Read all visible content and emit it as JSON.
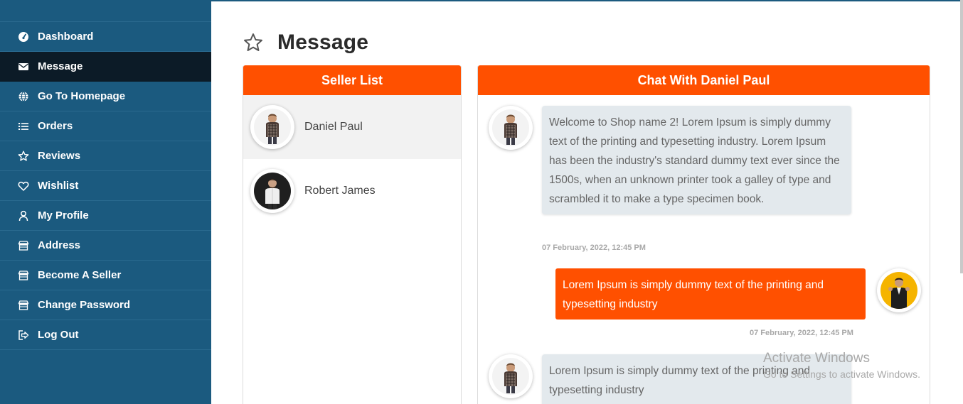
{
  "sidebar": {
    "items": [
      {
        "label": "Dashboard",
        "icon": "dashboard-icon"
      },
      {
        "label": "Message",
        "icon": "envelope-icon",
        "active": true
      },
      {
        "label": "Go To Homepage",
        "icon": "globe-icon"
      },
      {
        "label": "Orders",
        "icon": "list-icon"
      },
      {
        "label": "Reviews",
        "icon": "star-icon"
      },
      {
        "label": "Wishlist",
        "icon": "heart-icon"
      },
      {
        "label": "My Profile",
        "icon": "user-icon"
      },
      {
        "label": "Address",
        "icon": "store-icon"
      },
      {
        "label": "Become A Seller",
        "icon": "store-icon"
      },
      {
        "label": "Change Password",
        "icon": "store-icon"
      },
      {
        "label": "Log Out",
        "icon": "logout-icon"
      }
    ]
  },
  "page": {
    "title": "Message"
  },
  "seller_list": {
    "title": "Seller List",
    "sellers": [
      {
        "name": "Daniel Paul",
        "active": true
      },
      {
        "name": "Robert James",
        "active": false
      }
    ]
  },
  "chat": {
    "title": "Chat With Daniel Paul",
    "messages": [
      {
        "direction": "incoming",
        "text": "Welcome to Shop name 2! Lorem Ipsum is simply dummy text of the printing and typesetting industry. Lorem Ipsum has been the industry's standard dummy text ever since the 1500s, when an unknown printer took a galley of type and scrambled it to make a type specimen book.",
        "time": "07 February, 2022, 12:45 PM"
      },
      {
        "direction": "outgoing",
        "text": "Lorem Ipsum is simply dummy text of the printing and typesetting industry",
        "time": "07 February, 2022, 12:45 PM"
      },
      {
        "direction": "incoming",
        "text": "Lorem Ipsum is simply dummy text of the printing and typesetting industry"
      }
    ]
  },
  "watermark": {
    "title": "Activate Windows",
    "subtitle": "Go to Settings to activate Windows."
  },
  "colors": {
    "sidebar": "#1b5a7f",
    "sidebar_active": "#0c1b27",
    "accent": "#ff5000",
    "bubble_incoming": "#e3e9ed"
  }
}
